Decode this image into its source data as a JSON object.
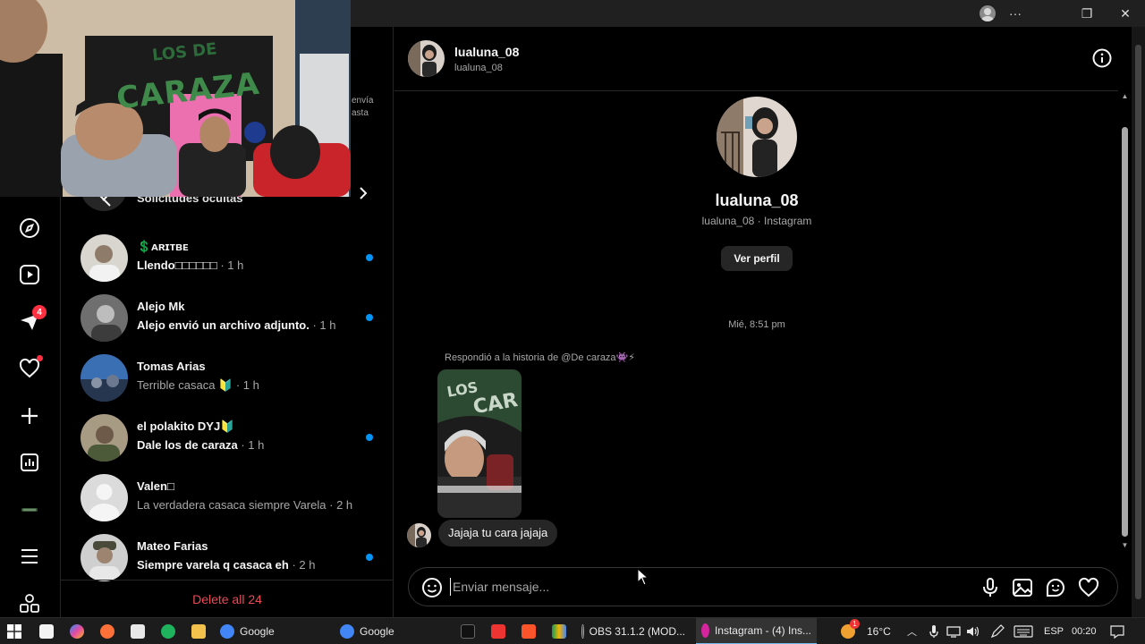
{
  "window": {
    "more_glyph": "···",
    "restore_glyph": "❐",
    "close_glyph": "✕"
  },
  "rail": {
    "notifications_badge": "4"
  },
  "conversations": {
    "hidden_requests_label": "Solicitudes ocultas",
    "items": [
      {
        "name": "💲ᴀʀɪᴛʙᴇ",
        "preview": "Llendo□□□□□□",
        "time": "· 1 h",
        "unread": true
      },
      {
        "name": "Alejo Mk",
        "preview": "Alejo envió un archivo adjunto.",
        "time": "· 1 h",
        "unread": true
      },
      {
        "name": "Tomas Arias",
        "preview": "Terrible casaca 🔰",
        "time": "· 1 h",
        "unread": false
      },
      {
        "name": "el polakito DYJ🔰",
        "preview": "Dale los de caraza",
        "time": "· 1 h",
        "unread": true
      },
      {
        "name": "Valen□",
        "preview": "La verdadera casaca siempre Varela",
        "time": "· 2 h",
        "unread": false
      },
      {
        "name": "Mateo Farias",
        "preview": "Siempre varela q casaca eh",
        "time": "· 2 h",
        "unread": true
      }
    ],
    "delete_all_label": "Delete all 24"
  },
  "webcam": {
    "banner_top": "LOS DE",
    "banner_bottom": "CARAZA",
    "overlay_text_1": "envía",
    "overlay_text_2": "asta"
  },
  "chat": {
    "header_name": "lualuna_08",
    "header_username": "lualuna_08",
    "profile_name": "lualuna_08",
    "profile_sub": "lualuna_08 · Instagram",
    "view_profile_label": "Ver perfil",
    "timestamp": "Mié, 8:51 pm",
    "story_reply_label": "Respondió a la historia de @De caraza👾⚡",
    "message": "Jajaja tu cara jajaja",
    "composer_placeholder": "Enviar mensaje..."
  },
  "taskbar": {
    "apps": [
      {
        "label": "Google",
        "color": "#4285f4"
      },
      {
        "label": "Google",
        "color": "#4285f4"
      },
      {
        "label": "OBS 31.1.2 (MOD...",
        "color": "#3a3a3a"
      },
      {
        "label": "Instagram - (4) Ins...",
        "color": "#d6249f"
      }
    ],
    "temperature": "16°C",
    "language": "ESP",
    "clock": "00:20",
    "weather_badge": "1"
  },
  "colors": {
    "accent_blue": "#0095f6",
    "danger_red": "#ed4956",
    "badge_red": "#ff3040",
    "surface": "#262626"
  }
}
